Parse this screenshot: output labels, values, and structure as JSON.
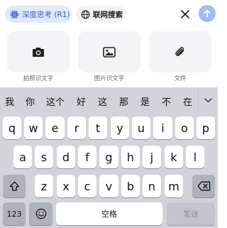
{
  "toolbar": {
    "deep_think_label": "深度思考 (R1)",
    "web_search_label": "联网搜索",
    "accent": "#3a63c9",
    "send_color": "#9fbdf4"
  },
  "attachments": [
    {
      "label": "拍照识文字",
      "icon": "camera-icon"
    },
    {
      "label": "图片识文字",
      "icon": "image-icon"
    },
    {
      "label": "文件",
      "icon": "paperclip-icon"
    }
  ],
  "keyboard": {
    "candidates": [
      "我",
      "你",
      "这个",
      "好",
      "这",
      "那",
      "是",
      "不",
      "在"
    ],
    "row1": [
      "q",
      "w",
      "e",
      "r",
      "t",
      "y",
      "u",
      "i",
      "o",
      "p"
    ],
    "row2": [
      "a",
      "s",
      "d",
      "f",
      "g",
      "h",
      "j",
      "k",
      "l"
    ],
    "row3": [
      "z",
      "x",
      "c",
      "v",
      "b",
      "n",
      "m"
    ],
    "numbers_label": "123",
    "space_label": "空格",
    "send_label": "发送",
    "emoji_icon": "emoji-icon",
    "shift_icon": "shift-icon",
    "backspace_icon": "backspace-icon"
  }
}
